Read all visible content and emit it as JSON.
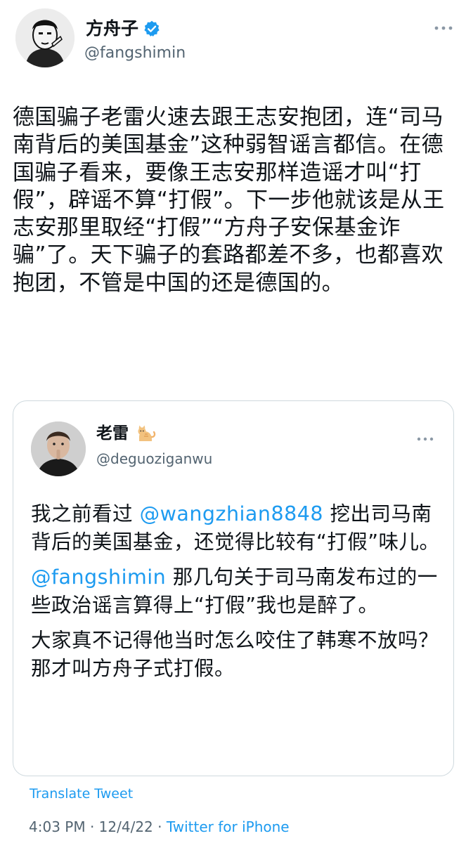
{
  "author": {
    "display_name": "方舟子",
    "handle": "@fangshimin",
    "verified": true
  },
  "tweet": {
    "text": "德国骗子老雷火速去跟王志安抱团，连“司马南背后的美国基金”这种弱智谣言都信。在德国骗子看来，要像王志安那样造谣才叫“打假”，辟谣不算“打假”。下一步他就该是从王志安那里取经“打假”“方舟子安保基金诈骗”了。天下骗子的套路都差不多，也都喜欢抱团，不管是中国的还是德国的。"
  },
  "quoted_tweet": {
    "display_name": "老雷",
    "emoji": "cat-emoji",
    "handle": "@deguoziganwu",
    "paragraphs": [
      {
        "mention": "@wangzhian8848",
        "before": "我之前看过 ",
        "after": " 挖出司马南背后的美国基金，还觉得比较有“打假”味儿。"
      },
      {
        "mention": "@fangshimin",
        "before": "",
        "after": " 那几句关于司马南发布过的一些政治谣言算得上“打假”我也是醉了。"
      },
      {
        "mention": "",
        "before": "大家真不记得他当时怎么咬住了韩寒不放吗？那才叫方舟子式打假。",
        "after": ""
      }
    ]
  },
  "footer": {
    "translate_label": "Translate Tweet",
    "time": "4:03 PM",
    "separator": " · ",
    "date": "12/4/22",
    "source": "Twitter for iPhone"
  },
  "colors": {
    "accent": "#1d9bf0",
    "secondary_text": "#536471",
    "border": "#cfd9de"
  }
}
